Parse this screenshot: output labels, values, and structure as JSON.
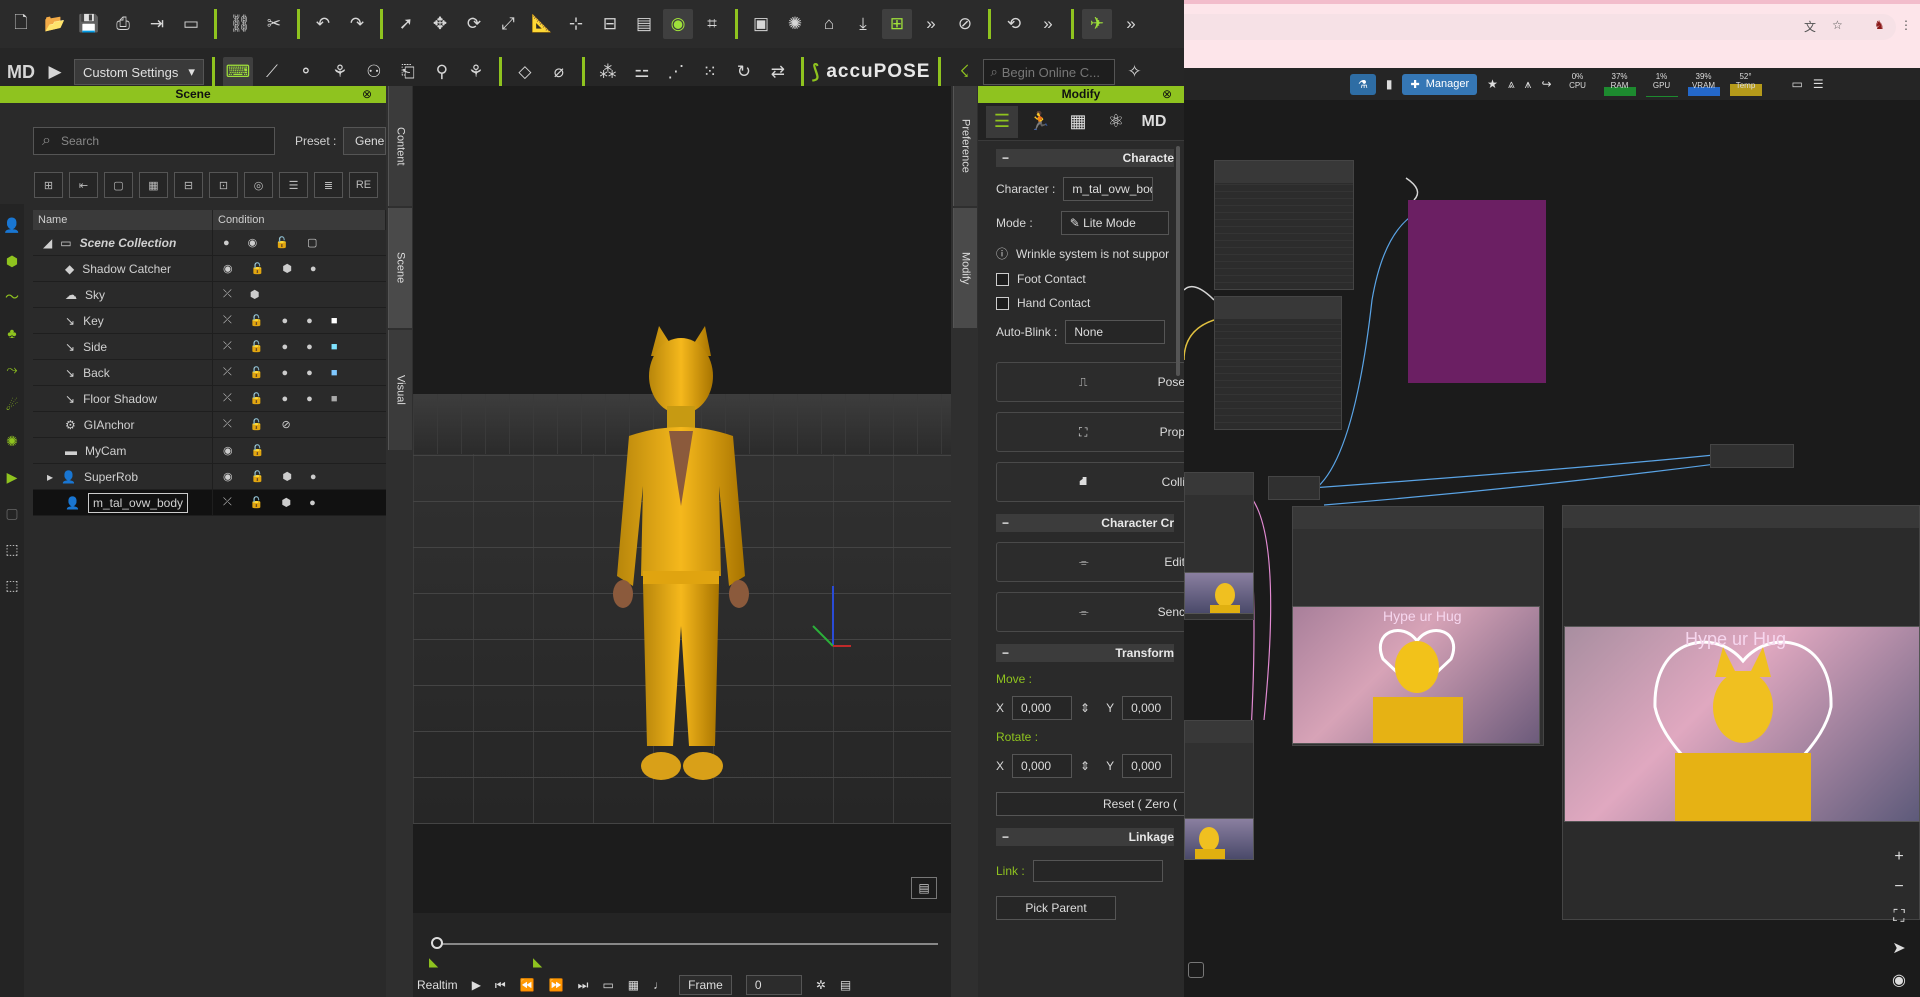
{
  "toolbar": {
    "preset_label": "Custom Settings",
    "brand": "accuPOSE",
    "search_placeholder": "Begin Online C...",
    "logo": "MD"
  },
  "scene_panel": {
    "title": "Scene",
    "search_placeholder": "Search",
    "preset_label": "Preset :",
    "preset_value": "Gene",
    "columns": [
      "Name",
      "Condition"
    ],
    "rows": [
      {
        "name": "Scene Collection",
        "bold": true
      },
      {
        "name": "Shadow Catcher"
      },
      {
        "name": "Sky"
      },
      {
        "name": "Key"
      },
      {
        "name": "Side"
      },
      {
        "name": "Back"
      },
      {
        "name": "Floor Shadow"
      },
      {
        "name": "GIAnchor"
      },
      {
        "name": "MyCam"
      },
      {
        "name": "SuperRob"
      },
      {
        "name": "m_tal_ovw_body",
        "selected": true
      }
    ],
    "tabs": [
      "Content",
      "Scene",
      "Visual"
    ]
  },
  "modify_panel": {
    "title": "Modify",
    "side_tabs": [
      "Preference",
      "Modify"
    ],
    "section_character": "Characte",
    "character_label": "Character :",
    "character_value": "m_tal_ovw_body",
    "mode_label": "Mode :",
    "mode_value": "Lite Mode",
    "wrinkle_note": "Wrinkle system is not suppor",
    "foot_contact": "Foot Contact",
    "hand_contact": "Hand Contact",
    "autoblink_label": "Auto-Blink :",
    "autoblink_value": "None",
    "btn_pose": "Pose",
    "btn_prop": "Prop",
    "btn_colli": "Colli",
    "section_character_cr": "Character Cr",
    "btn_edit": "Edit",
    "btn_send": "Senc",
    "section_transform": "Transform",
    "move_label": "Move :",
    "rotate_label": "Rotate :",
    "x_label": "X",
    "y_label": "Y",
    "move_x": "0,000",
    "move_y": "0,000",
    "rotate_x": "0,000",
    "rotate_y": "0,000",
    "reset_label": "Reset ( Zero (",
    "section_linkage": "Linkage",
    "link_label": "Link :",
    "pick_parent": "Pick Parent"
  },
  "timeline": {
    "mode": "Realtim",
    "frame_label": "Frame",
    "frame_value": "0"
  },
  "comfy": {
    "manager_label": "Manager",
    "stats": [
      {
        "name": "CPU",
        "value": "0%",
        "level": 0.0
      },
      {
        "name": "RAM",
        "value": "37%",
        "level": 0.37
      },
      {
        "name": "GPU",
        "value": "1%",
        "level": 0.01
      },
      {
        "name": "VRAM",
        "value": "39%",
        "level": 0.39
      },
      {
        "name": "Temp",
        "value": "52°",
        "level": 0.52
      }
    ],
    "photo_caption": "Hype ur Hug"
  }
}
